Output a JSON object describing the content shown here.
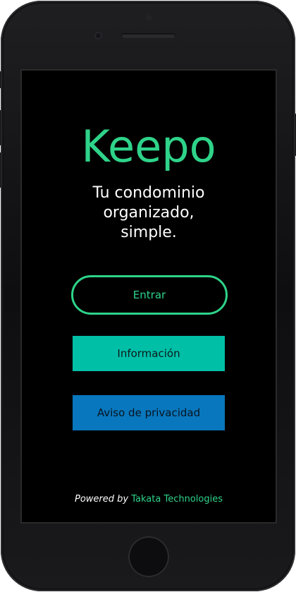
{
  "app": {
    "logo_text": "Keepo",
    "tagline": "Tu condominio\norganizado,\nsimple."
  },
  "buttons": {
    "login_label": "Entrar",
    "info_label": "Información",
    "privacy_label": "Aviso de privacidad"
  },
  "footer": {
    "powered_by": "Powered by",
    "company": "Takata Technologies"
  },
  "colors": {
    "brand_green": "#2ed389",
    "info_teal": "#00bfa7",
    "privacy_blue": "#0877bd",
    "background": "#000000"
  }
}
